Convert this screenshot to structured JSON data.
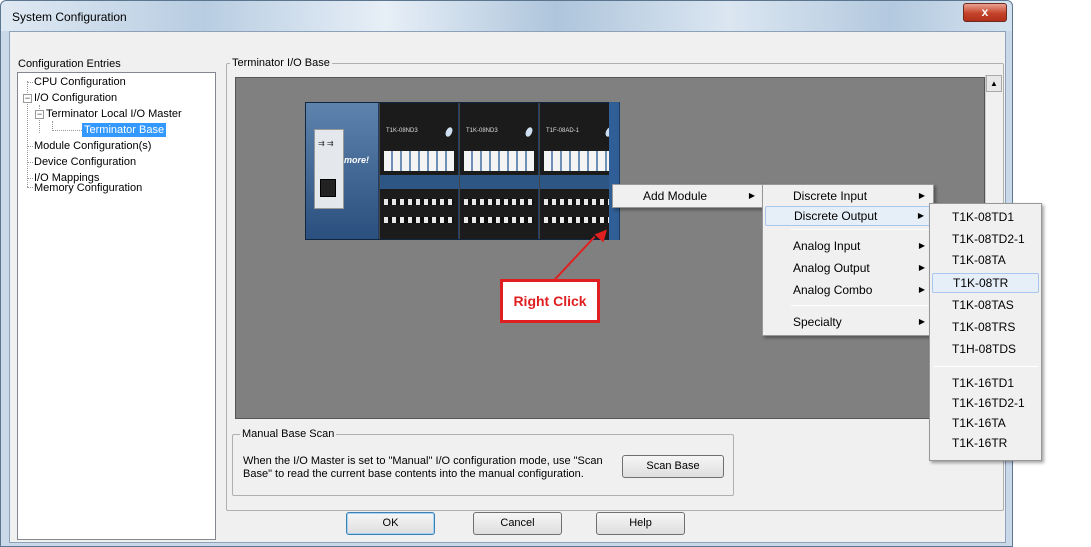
{
  "window": {
    "title": "System Configuration",
    "close_label": "x"
  },
  "left_panel": {
    "label": "Configuration Entries",
    "tree": {
      "cpu": "CPU Configuration",
      "io": "I/O Configuration",
      "master": "Terminator Local I/O Master",
      "base": "Terminator Base",
      "module": "Module Configuration(s)",
      "device": "Device Configuration",
      "mappings": "I/O Mappings",
      "memory": "Memory Configuration"
    }
  },
  "base_group": {
    "label": "Terminator I/O Base"
  },
  "hardware": {
    "cpu_logo": "more!",
    "modules": [
      "T1K-08ND3",
      "T1K-08ND3",
      "T1F-08AD-1"
    ]
  },
  "annotation": {
    "text": "Right Click"
  },
  "context_menu": {
    "add_module": "Add Module"
  },
  "submenu": {
    "items": [
      "Discrete Input",
      "Discrete Output",
      "Analog Input",
      "Analog Output",
      "Analog Combo",
      "Specialty"
    ]
  },
  "output_menu": {
    "items": [
      "T1K-08TD1",
      "T1K-08TD2-1",
      "T1K-08TA",
      "T1K-08TR",
      "T1K-08TAS",
      "T1K-08TRS",
      "T1H-08TDS",
      "T1K-16TD1",
      "T1K-16TD2-1",
      "T1K-16TA",
      "T1K-16TR"
    ]
  },
  "scan": {
    "label": "Manual Base Scan",
    "description": "When the I/O Master is set to \"Manual\" I/O configuration mode, use \"Scan Base\" to read the current base contents into the manual configuration.",
    "button": "Scan Base"
  },
  "footer": {
    "ok": "OK",
    "cancel": "Cancel",
    "help": "Help"
  },
  "colors": {
    "accent": "#3399ff",
    "annotation": "#e02020",
    "canvas": "#808080"
  }
}
